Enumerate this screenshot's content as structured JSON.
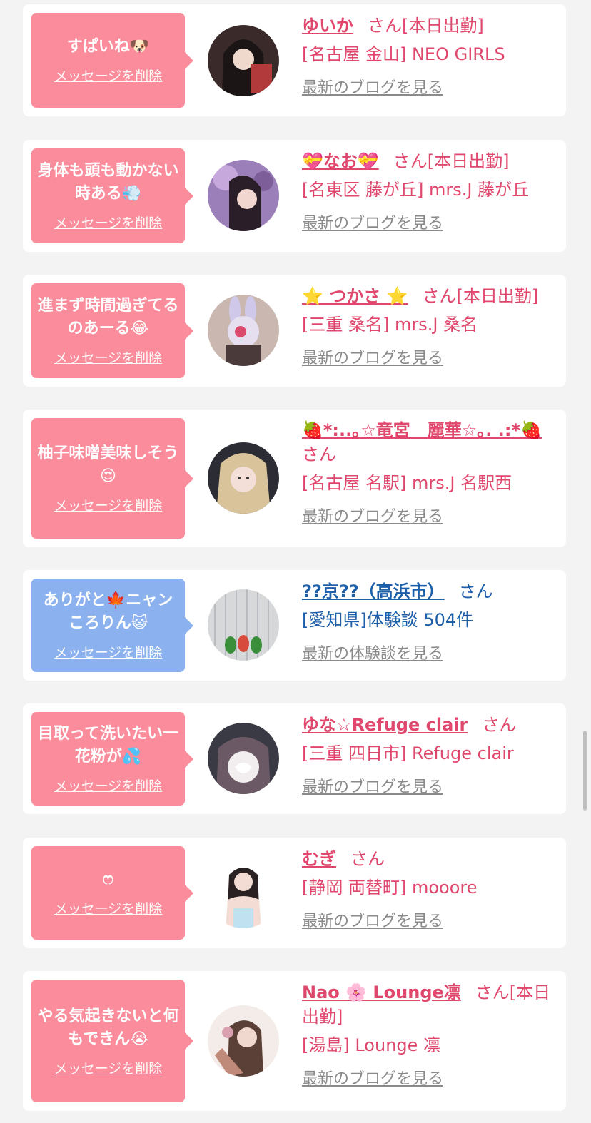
{
  "delete_label": "メッセージを削除",
  "san_label": "さん",
  "cards": [
    {
      "message": "すぱいね🐶",
      "name": "ゆいか",
      "status": "[本日出勤]",
      "shop": "[名古屋 金山] NEO GIRLS",
      "link": "最新のブログを見る"
    },
    {
      "message": "身体も頭も動かない時ある💨",
      "name": "💝なお💝",
      "status": "[本日出勤]",
      "shop": "[名東区 藤が丘] mrs.J 藤が丘",
      "link": "最新のブログを見る"
    },
    {
      "message": "進まず時間過ぎてるのあーる😂",
      "name": "⭐ つかさ ⭐",
      "status": "[本日出勤]",
      "shop": "[三重 桑名] mrs.J 桑名",
      "link": "最新のブログを見る"
    },
    {
      "message": "柚子味噌美味しそう😍",
      "name": "🍓*:..｡☆竜宮　麗華☆｡. .:*🍓",
      "status": "",
      "shop": "[名古屋 名駅] mrs.J 名駅西",
      "link": "最新のブログを見る"
    },
    {
      "message": "ありがと🍁ニャンころりん😺",
      "name": "??京??（高浜市）",
      "status": "",
      "shop": "[愛知県]体験談 504件",
      "link": "最新の体験談を見る"
    },
    {
      "message": "目取って洗いたい一花粉が💦",
      "name": "ゆな☆Refuge clair",
      "status": "",
      "shop": "[三重 四日市] Refuge clair",
      "link": "最新のブログを見る"
    },
    {
      "message": "ෆ",
      "name": "むぎ",
      "status": "",
      "shop": "[静岡 両替町] mooore",
      "link": "最新のブログを見る"
    },
    {
      "message": "やる気起きないと何もできん😭",
      "name": "Nao 🌸 Lounge凛",
      "status": "[本日出勤]",
      "shop": "[湯島] Lounge 凛",
      "link": "最新のブログを見る"
    }
  ]
}
